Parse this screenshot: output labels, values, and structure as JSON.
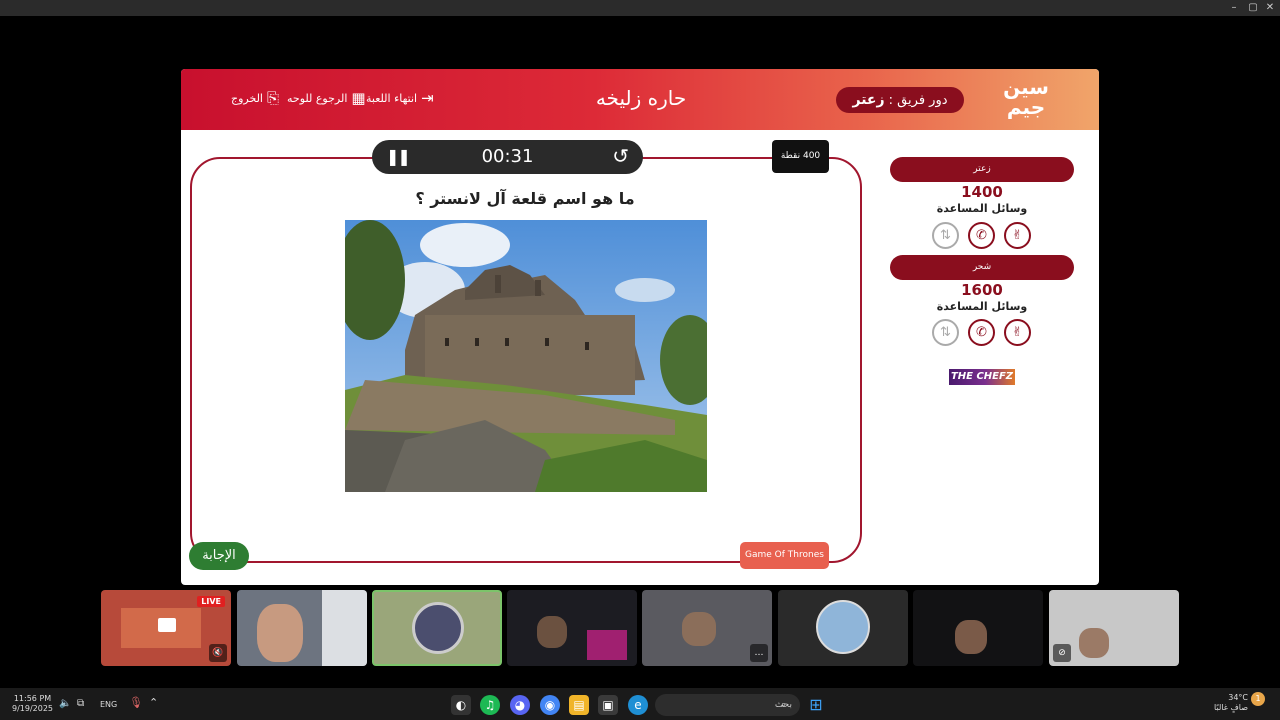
{
  "window": {
    "minimize_icon": "minimize-icon",
    "maximize_icon": "maximize-icon",
    "close_icon": "close-icon"
  },
  "header": {
    "logo_line1": "سين",
    "logo_line2": "جيم",
    "turn_label": "دور فريق :",
    "turn_team": "زعتر",
    "title": "حاره زليخه",
    "end_game": "انتهاء اللعبة",
    "back_to_board": "الرجوع للوحه",
    "exit": "الخروج",
    "colors": {
      "brand": "#c8102e",
      "accent": "#8a0e1e"
    }
  },
  "question": {
    "timer": "00:31",
    "points": "400 نقطة",
    "text": "ما هو اسم قلعة آل لانستر ؟",
    "answer_button": "الإجابة",
    "category": "Game Of Thrones"
  },
  "teams": [
    {
      "name": "زعتر",
      "score": "1400",
      "aids_label": "وسائل المساعدة"
    },
    {
      "name": "شحر",
      "score": "1600",
      "aids_label": "وسائل المساعدة"
    }
  ],
  "sponsor": {
    "text": "THE CHEFZ"
  },
  "call": {
    "live_badge": "LIVE"
  },
  "taskbar": {
    "time": "11:56 PM",
    "date": "9/19/2025",
    "lang": "ENG",
    "search_placeholder": "بحث",
    "temperature": "34°C",
    "weather": "صافٍ غالبًا",
    "notification_count": "1"
  }
}
